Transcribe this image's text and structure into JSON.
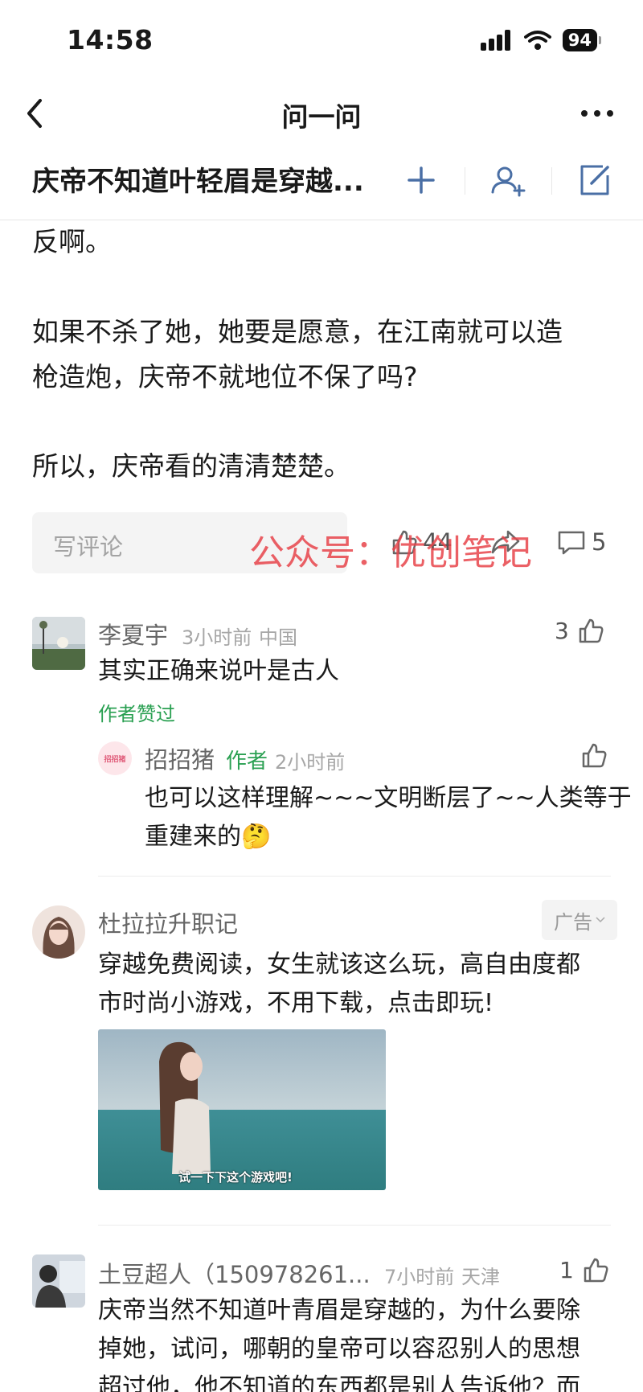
{
  "status_bar": {
    "time": "14:58",
    "battery": "94"
  },
  "nav": {
    "title": "问一问"
  },
  "question": {
    "title": "庆帝不知道叶轻眉是穿越..."
  },
  "answer": {
    "paragraphs": [
      "反啊。",
      "如果不杀了她，她要是愿意，在江南就可以造",
      "枪造炮，庆帝不就地位不保了吗?",
      "所以，庆帝看的清清楚楚。"
    ]
  },
  "actions": {
    "comment_placeholder": "写评论",
    "like_count": "44",
    "comment_count": "5",
    "watermark": "公众号：优创笔记"
  },
  "comments": [
    {
      "name": "李夏宇",
      "time": "3小时前",
      "location": "中国",
      "likes": "3",
      "text": "其实正确来说叶是古人",
      "badge": "作者赞过",
      "reply": {
        "avatar_text": "招招猪",
        "name": "招招猪",
        "author_tag": "作者",
        "time": "2小时前",
        "text_line1": "也可以这样理解~~~文明断层了~~人类等于",
        "text_line2": "重建来的🤔"
      }
    },
    {
      "name": "杜拉拉升职记",
      "ad_label": "广告",
      "text_line1": "穿越免费阅读，女生就该这么玩，高自由度都",
      "text_line2": "市时尚小游戏，不用下载，点击即玩!",
      "image_caption": "试一下下这个游戏吧!"
    },
    {
      "name": "土豆超人（150978261...",
      "time": "7小时前",
      "location": "天津",
      "likes": "1",
      "text_line1": "庆帝当然不知道叶青眉是穿越的，为什么要除",
      "text_line2": "掉她，试问，哪朝的皇帝可以容忍别人的思想",
      "text_line3": "超过他，他不知道的东西都是别人告诉他？而"
    }
  ],
  "colors": {
    "accent_blue": "#4a6fa5",
    "green": "#2aa052",
    "watermark_red": "#e8454b"
  }
}
